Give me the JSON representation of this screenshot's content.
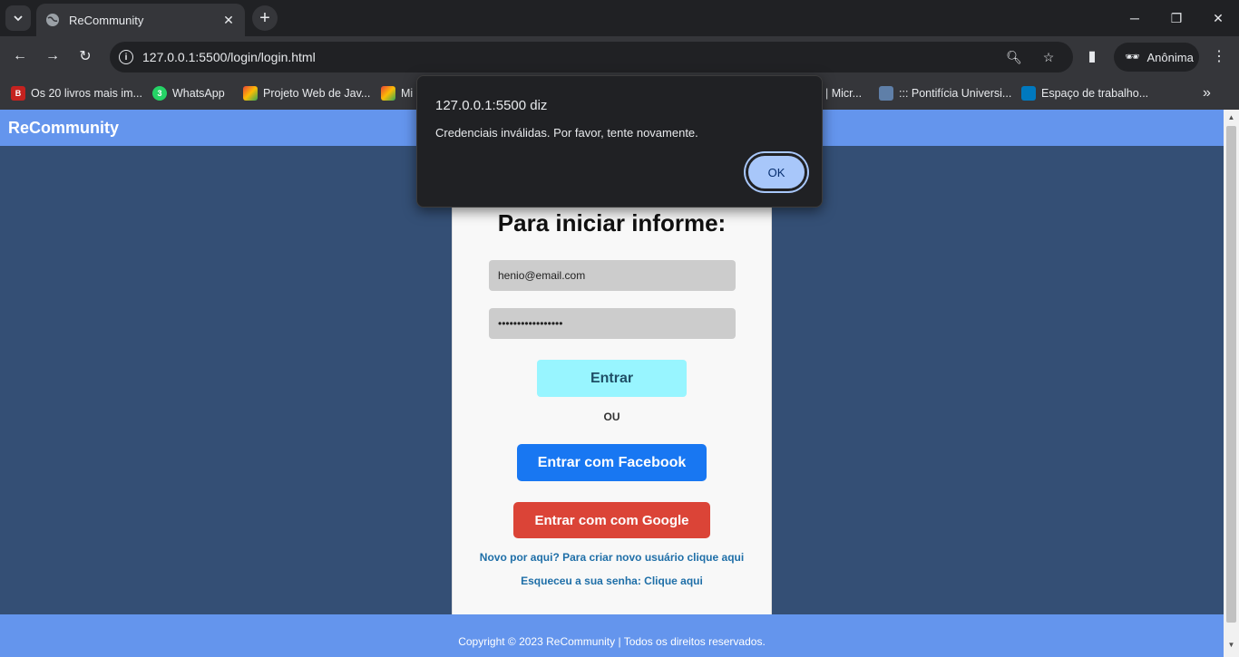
{
  "browser": {
    "tab_title": "ReCommunity",
    "address": "127.0.0.1:5500/login/login.html",
    "profile_label": "Anônima",
    "bookmarks": [
      {
        "label": "Os 20 livros mais im...",
        "icon": "B"
      },
      {
        "label": "WhatsApp",
        "icon": "3"
      },
      {
        "label": "Projeto Web de Jav...",
        "icon": ""
      },
      {
        "label": "Mi",
        "icon": ""
      },
      {
        "label": "| Micr...",
        "icon": ""
      },
      {
        "label": "::: Pontifícia Universi...",
        "icon": ""
      },
      {
        "label": "Espaço de trabalho...",
        "icon": ""
      }
    ],
    "more_bookmarks": "»"
  },
  "page": {
    "brand": "ReCommunity",
    "heading": "Para iniciar informe:",
    "email_value": "henio@email.com",
    "password_value": "•••••••••••••••••",
    "login_button": "Entrar",
    "or_label": "OU",
    "facebook_button": "Entrar com Facebook",
    "google_button": "Entrar com com Google",
    "signup_link": "Novo por aqui? Para criar novo usuário clique aqui",
    "forgot_link": "Esqueceu a sua senha: Clique aqui",
    "footer": "Copyright © 2023 ReCommunity | Todos os direitos reservados."
  },
  "dialog": {
    "title": "127.0.0.1:5500 diz",
    "message": "Credenciais inválidas. Por favor, tente novamente.",
    "ok_label": "OK"
  },
  "colors": {
    "header": "#6495ed",
    "background": "#344f75",
    "entrar": "#98f5ff",
    "facebook": "#1877f2",
    "google": "#db4437",
    "link": "#1f6fa8"
  }
}
